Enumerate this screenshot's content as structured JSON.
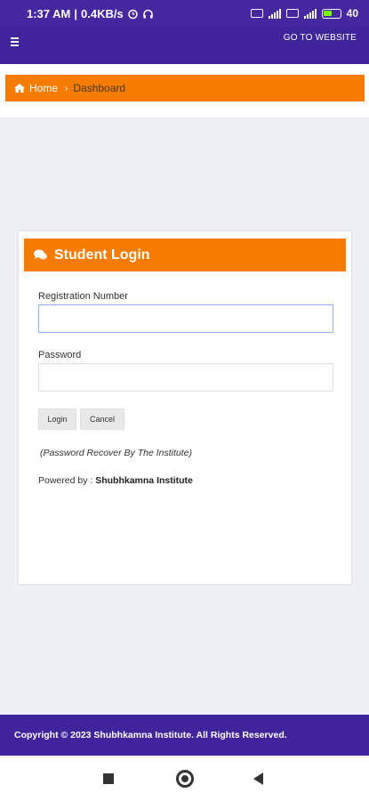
{
  "status_bar": {
    "time": "1:37 AM",
    "net_speed": "0.4KB/s",
    "battery": "40"
  },
  "topbar": {
    "go_to_website": "GO TO WEBSITE"
  },
  "breadcrumb": {
    "home": "Home",
    "current": "Dashboard"
  },
  "login_card": {
    "title": "Student Login",
    "registration_label": "Registration Number",
    "registration_value": "",
    "password_label": "Password",
    "password_value": "",
    "login_button": "Login",
    "cancel_button": "Cancel",
    "recover_note": "(Password Recover By The Institute)",
    "powered_by_prefix": "Powered by :",
    "powered_by_name": "Shubhkamna Institute"
  },
  "footer": {
    "copyright": "Copyright © 2023 Shubhkamna Institute. All Rights Reserved."
  },
  "colors": {
    "header": "#3f249b",
    "accent": "#f57c00"
  }
}
